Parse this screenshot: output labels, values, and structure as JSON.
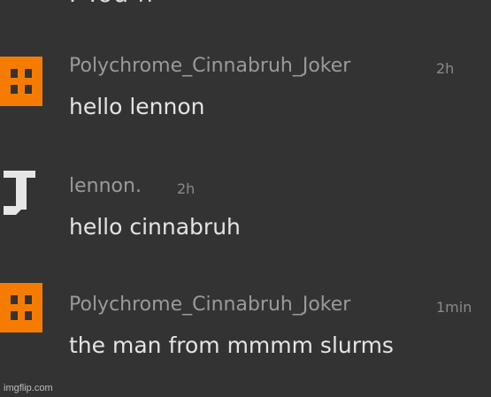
{
  "top_partial_text": "I You h",
  "messages": [
    {
      "username": "Polychrome_Cinnabruh_Joker",
      "time": "2h",
      "text": "hello lennon",
      "avatar_color": "#f57c00",
      "avatar_icon": "orange-glyph-avatar"
    },
    {
      "username": "lennon.",
      "time": "2h",
      "text": "hello cinnabruh",
      "avatar_color": "#e6e6e6",
      "avatar_icon": "letter-j-avatar"
    },
    {
      "username": "Polychrome_Cinnabruh_Joker",
      "time": "1min",
      "text": "the man from mmmm slurms",
      "avatar_color": "#f57c00",
      "avatar_icon": "orange-glyph-avatar"
    }
  ],
  "watermark": "imgflip.com"
}
